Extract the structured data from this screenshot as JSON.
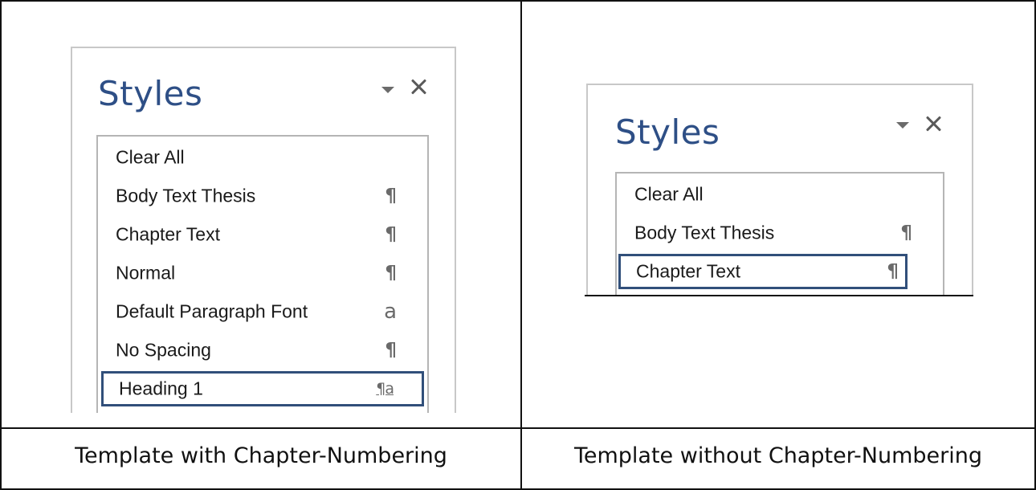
{
  "left_panel": {
    "title": "Styles",
    "dropdown_icon": "chevron-down-icon",
    "close_icon": "close-icon",
    "items": [
      {
        "label": "Clear All",
        "glyph": ""
      },
      {
        "label": "Body Text Thesis",
        "glyph": "¶"
      },
      {
        "label": "Chapter Text",
        "glyph": "¶"
      },
      {
        "label": "Normal",
        "glyph": "¶"
      },
      {
        "label": "Default Paragraph Font",
        "glyph": "a"
      },
      {
        "label": "No Spacing",
        "glyph": "¶"
      },
      {
        "label": "Heading 1",
        "glyph": "¶a",
        "selected": true
      }
    ]
  },
  "right_panel": {
    "title": "Styles",
    "dropdown_icon": "chevron-down-icon",
    "close_icon": "close-icon",
    "items": [
      {
        "label": "Clear All",
        "glyph": ""
      },
      {
        "label": "Body Text Thesis",
        "glyph": "¶"
      },
      {
        "label": "Chapter Text",
        "glyph": "¶",
        "selected": true
      }
    ]
  },
  "captions": {
    "left": "Template with Chapter-Numbering",
    "right": "Template without Chapter-Numbering"
  },
  "colors": {
    "title": "#2e4f86",
    "selection_border": "#314f7a",
    "glyph": "#6a6a6a"
  }
}
